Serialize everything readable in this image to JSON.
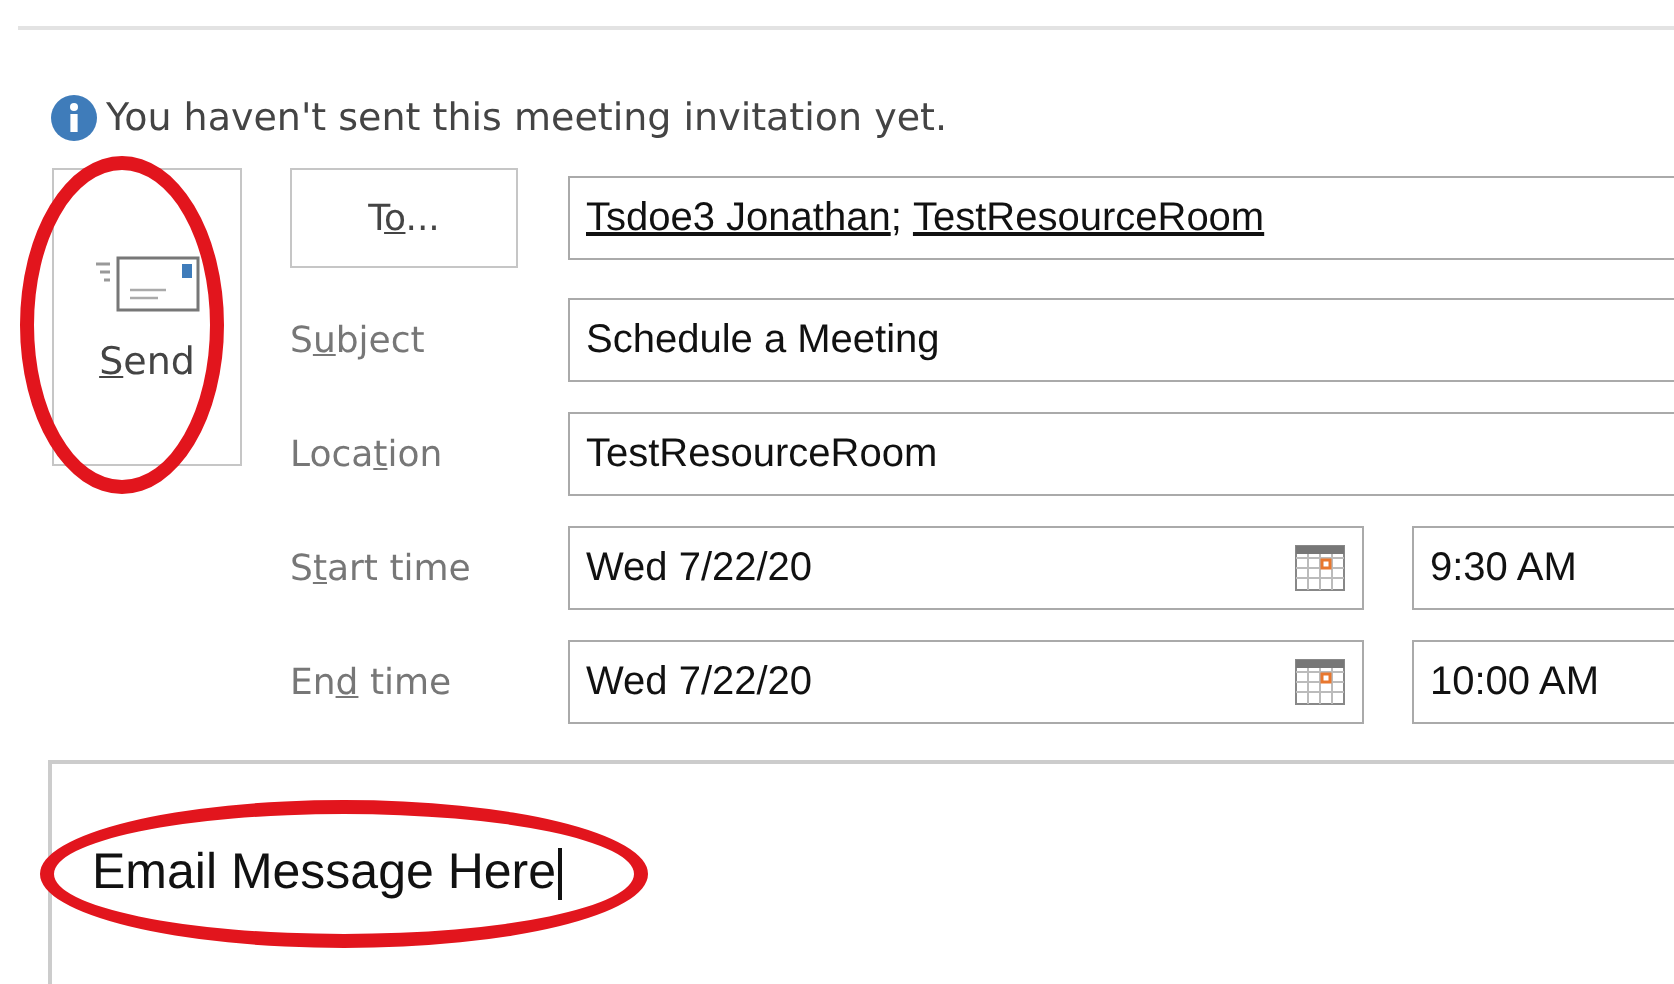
{
  "info_bar": {
    "text": "You haven't sent this meeting invitation yet."
  },
  "send_button": {
    "label": {
      "key": "S",
      "post": "end"
    },
    "circled": true
  },
  "to_button": {
    "label": {
      "pre": "T",
      "key": "o",
      "post": "..."
    }
  },
  "recipients": {
    "items": [
      "Tsdoe3 Jonathan",
      "TestResourceRoom"
    ],
    "separator": ";"
  },
  "subject": {
    "label": {
      "pre": "S",
      "key": "u",
      "post": "bject"
    },
    "value": "Schedule a Meeting"
  },
  "location": {
    "label": {
      "pre": "Loca",
      "key": "t",
      "post": "ion"
    },
    "value": "TestResourceRoom"
  },
  "times": [
    {
      "label": {
        "pre": "S",
        "key": "t",
        "post": "art time"
      },
      "date": "Wed 7/22/20",
      "time": "9:30 AM"
    },
    {
      "label": {
        "pre": "En",
        "key": "d",
        "post": " time"
      },
      "date": "Wed 7/22/20",
      "time": "10:00 AM"
    }
  ],
  "body": {
    "text": "Email Message Here",
    "circled": true
  }
}
